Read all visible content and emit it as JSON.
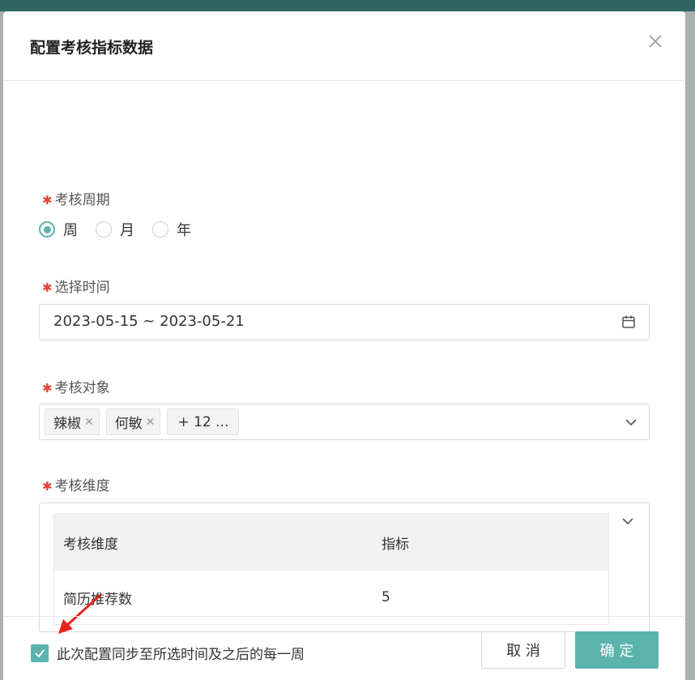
{
  "dialog": {
    "title": "配置考核指标数据"
  },
  "fields": {
    "period": {
      "label": "考核周期",
      "options": [
        "周",
        "月",
        "年"
      ],
      "selected": "周"
    },
    "time": {
      "label": "选择时间",
      "value": "2023-05-15 ~ 2023-05-21"
    },
    "target": {
      "label": "考核对象",
      "tags": [
        "辣椒",
        "何敏"
      ],
      "more": "+ 12 ..."
    },
    "dimension": {
      "label": "考核维度",
      "table": {
        "headers": [
          "考核维度",
          "指标"
        ],
        "rows": [
          [
            "简历推荐数",
            "5"
          ]
        ]
      }
    }
  },
  "footer": {
    "sync_label": "此次配置同步至所选时间及之后的每一周",
    "sync_checked": true,
    "cancel_label": "取 消",
    "ok_label": "确 定"
  },
  "colors": {
    "accent": "#5bb3ad",
    "required": "#e0443c",
    "arrow": "#e8231f"
  }
}
